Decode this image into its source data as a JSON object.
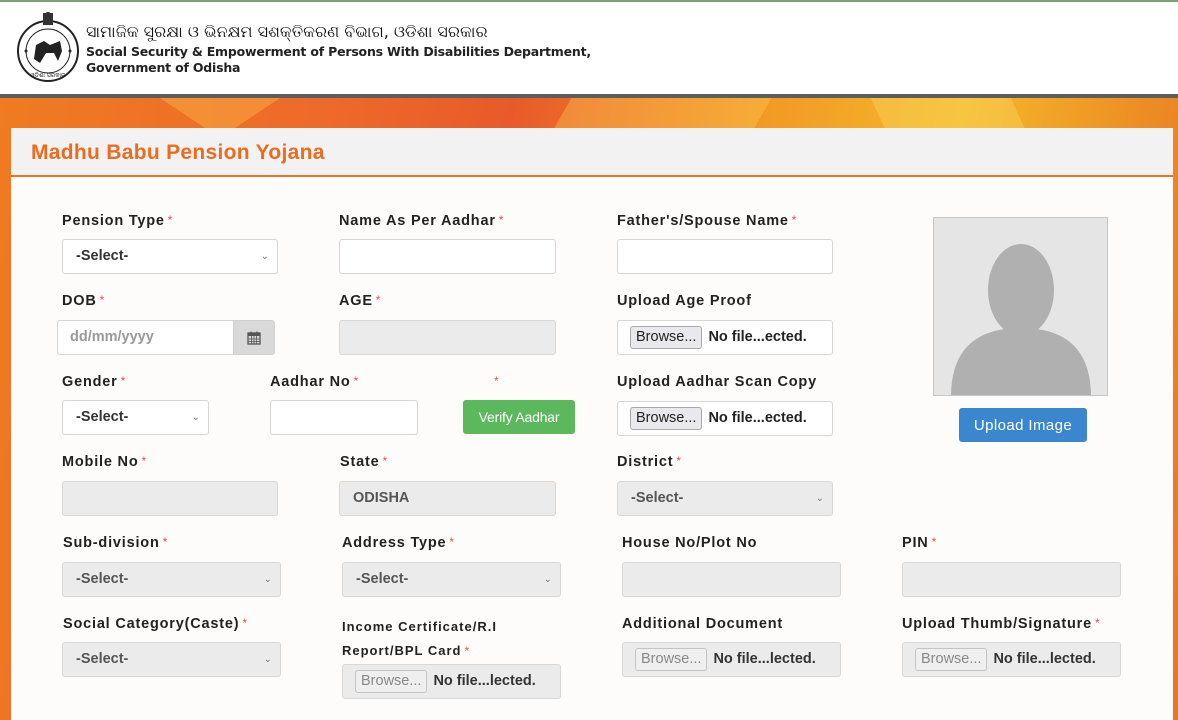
{
  "header": {
    "title_odia": "ସାମାଜିକ ସୁରକ୍ଷା ଓ ଭିନକ୍ଷମ ସଶକ୍ତିକରଣ ବିଭାଗ, ଓଡିଶା ସରକାର",
    "title_en_line1": "Social Security & Empowerment of Persons With Disabilities Department,",
    "title_en_line2": "Government of Odisha",
    "logo_icon": "odisha-government-emblem"
  },
  "form": {
    "title": "Madhu Babu Pension Yojana",
    "required_marker": "*",
    "colors": {
      "title": "#ec6b1f",
      "required": "#d9534f",
      "verify_button": "#5cb85c",
      "upload_button": "#3a87cf"
    },
    "fields": {
      "pension_type": {
        "label": "Pension Type",
        "value": "-Select-",
        "required": true
      },
      "name_as_per_aadhar": {
        "label": "Name As Per Aadhar",
        "value": "",
        "required": true
      },
      "father_spouse_name": {
        "label": "Father's/Spouse Name",
        "value": "",
        "required": true
      },
      "dob": {
        "label": "DOB",
        "placeholder": "dd/mm/yyyy",
        "required": true
      },
      "age": {
        "label": "AGE",
        "value": "",
        "required": true
      },
      "upload_age_proof": {
        "label": "Upload Age Proof",
        "browse": "Browse...",
        "status": "No file...ected."
      },
      "gender": {
        "label": "Gender",
        "value": "-Select-",
        "required": true
      },
      "aadhar_no": {
        "label": "Aadhar No",
        "value": "",
        "required": true
      },
      "upload_aadhar_scan": {
        "label": "Upload Aadhar Scan Copy",
        "browse": "Browse...",
        "status": "No file...ected."
      },
      "mobile_no": {
        "label": "Mobile No",
        "value": "",
        "required": true
      },
      "state": {
        "label": "State",
        "value": "ODISHA",
        "required": true
      },
      "district": {
        "label": "District",
        "value": "-Select-",
        "required": true
      },
      "sub_division": {
        "label": "Sub-division",
        "value": "-Select-",
        "required": true
      },
      "address_type": {
        "label": "Address Type",
        "value": "-Select-",
        "required": true
      },
      "house_no": {
        "label": "House No/Plot No",
        "value": ""
      },
      "pin": {
        "label": "PIN",
        "value": "",
        "required": true
      },
      "social_category": {
        "label": "Social Category(Caste)",
        "value": "-Select-",
        "required": true
      },
      "income_certificate": {
        "label_line1": "Income Certificate/R.I",
        "label_line2": "Report/BPL Card",
        "browse": "Browse...",
        "status": "No file...lected.",
        "required": true
      },
      "additional_document": {
        "label": "Additional Document",
        "browse": "Browse...",
        "status": "No file...lected."
      },
      "thumb_signature": {
        "label": "Upload Thumb/Signature",
        "browse": "Browse...",
        "status": "No file...lected.",
        "required": true
      }
    },
    "buttons": {
      "verify_aadhar": "Verify Aadhar",
      "upload_image": "Upload Image"
    },
    "icons": {
      "calendar": "calendar-icon",
      "chevron": "⌄",
      "avatar_placeholder": "user-silhouette-icon"
    }
  }
}
